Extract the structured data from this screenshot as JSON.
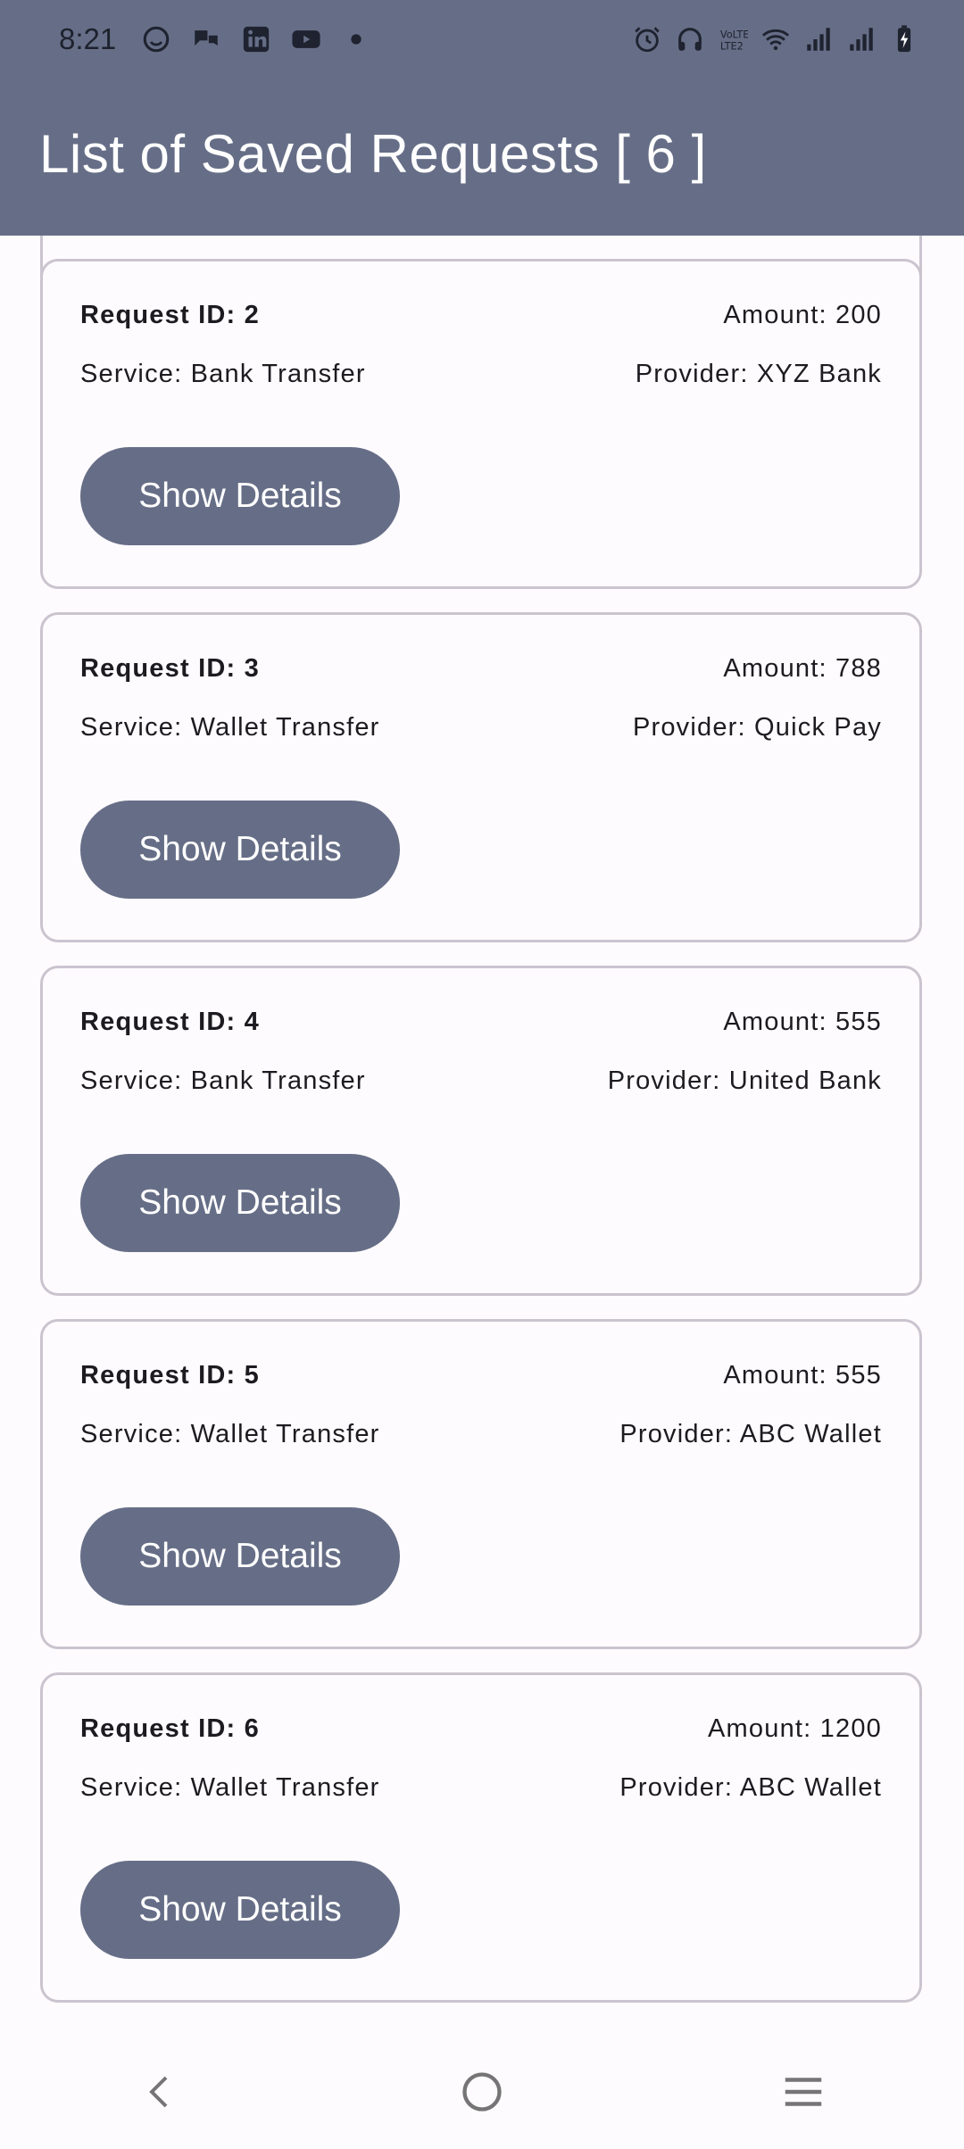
{
  "status_bar": {
    "time": "8:21",
    "left_icons": [
      "github-icon",
      "chat-icon",
      "linkedin-icon",
      "youtube-icon",
      "dot-icon"
    ],
    "right_icons": [
      "alarm-icon",
      "headphones-icon",
      "volte-icon",
      "wifi-icon",
      "signal-icon",
      "signal-icon",
      "battery-charging-icon"
    ]
  },
  "app_bar": {
    "title": "List of Saved Requests [ 6 ]"
  },
  "requests": [
    {
      "request_id": "Request ID: 2",
      "amount": "Amount: 200",
      "service": "Service: Bank Transfer",
      "provider": "Provider: XYZ Bank",
      "button_label": "Show Details"
    },
    {
      "request_id": "Request ID: 3",
      "amount": "Amount: 788",
      "service": "Service: Wallet Transfer",
      "provider": "Provider: Quick Pay",
      "button_label": "Show Details"
    },
    {
      "request_id": "Request ID: 4",
      "amount": "Amount: 555",
      "service": "Service: Bank Transfer",
      "provider": "Provider: United Bank",
      "button_label": "Show Details"
    },
    {
      "request_id": "Request ID: 5",
      "amount": "Amount: 555",
      "service": "Service: Wallet Transfer",
      "provider": "Provider: ABC Wallet",
      "button_label": "Show Details"
    },
    {
      "request_id": "Request ID: 6",
      "amount": "Amount: 1200",
      "service": "Service: Wallet Transfer",
      "provider": "Provider: ABC Wallet",
      "button_label": "Show Details"
    }
  ],
  "colors": {
    "primary": "#666e87",
    "background": "#fefbfe",
    "card_border": "#cac4cf",
    "on_primary": "#ffffff",
    "text": "#1c1b1f"
  },
  "nav_bar": {
    "icons": [
      "back-icon",
      "home-icon",
      "menu-icon"
    ]
  }
}
